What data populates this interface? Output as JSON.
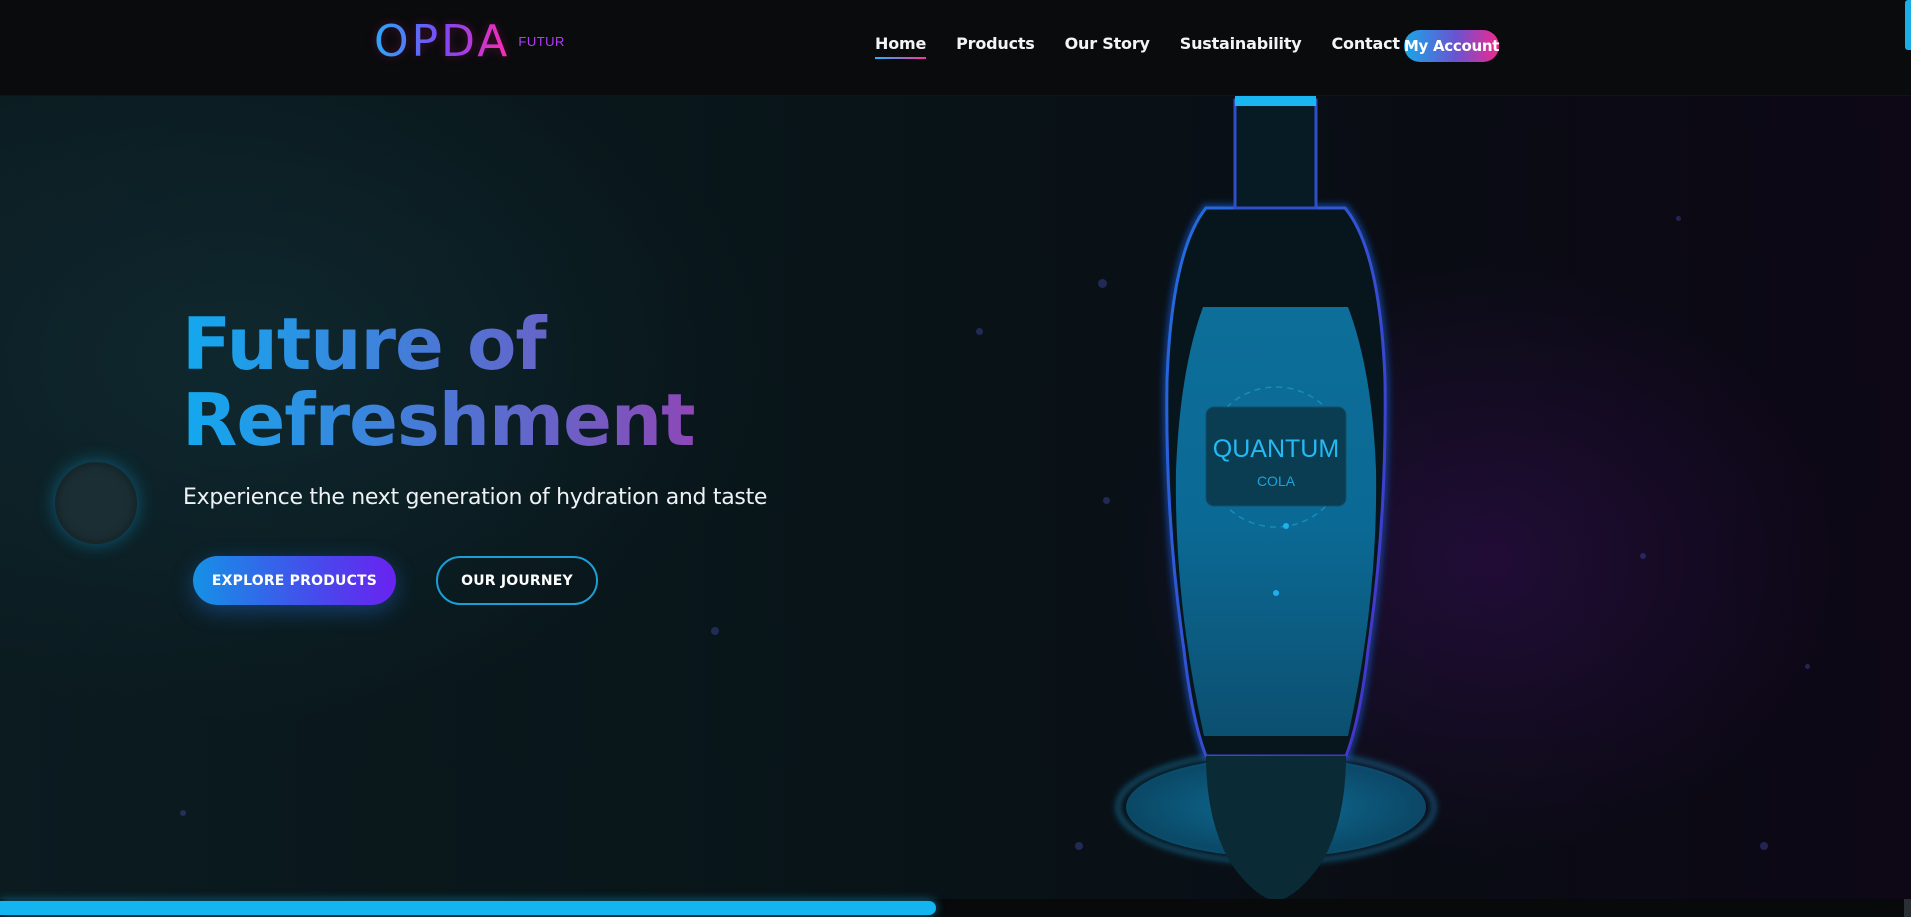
{
  "logo": {
    "mark": "OPDA",
    "sub": "FUTUR"
  },
  "nav": {
    "items": [
      {
        "label": "Home",
        "active": true
      },
      {
        "label": "Products",
        "active": false
      },
      {
        "label": "Our Story",
        "active": false
      },
      {
        "label": "Sustainability",
        "active": false
      },
      {
        "label": "Contact",
        "active": false
      }
    ],
    "account_label": "My Account"
  },
  "hero": {
    "title_line1": "Future of",
    "title_line2": "Refreshment",
    "subtitle": "Experience the next generation of hydration and taste",
    "primary_button": "EXPLORE PRODUCTS",
    "secondary_button": "OUR JOURNEY"
  },
  "bottle": {
    "brand": "QUANTUM",
    "product": "COLA"
  },
  "scroll_progress": 0.49,
  "colors": {
    "accent_cyan": "#12b5ef",
    "accent_purple": "#6a22f0",
    "accent_pink": "#f0288e"
  }
}
